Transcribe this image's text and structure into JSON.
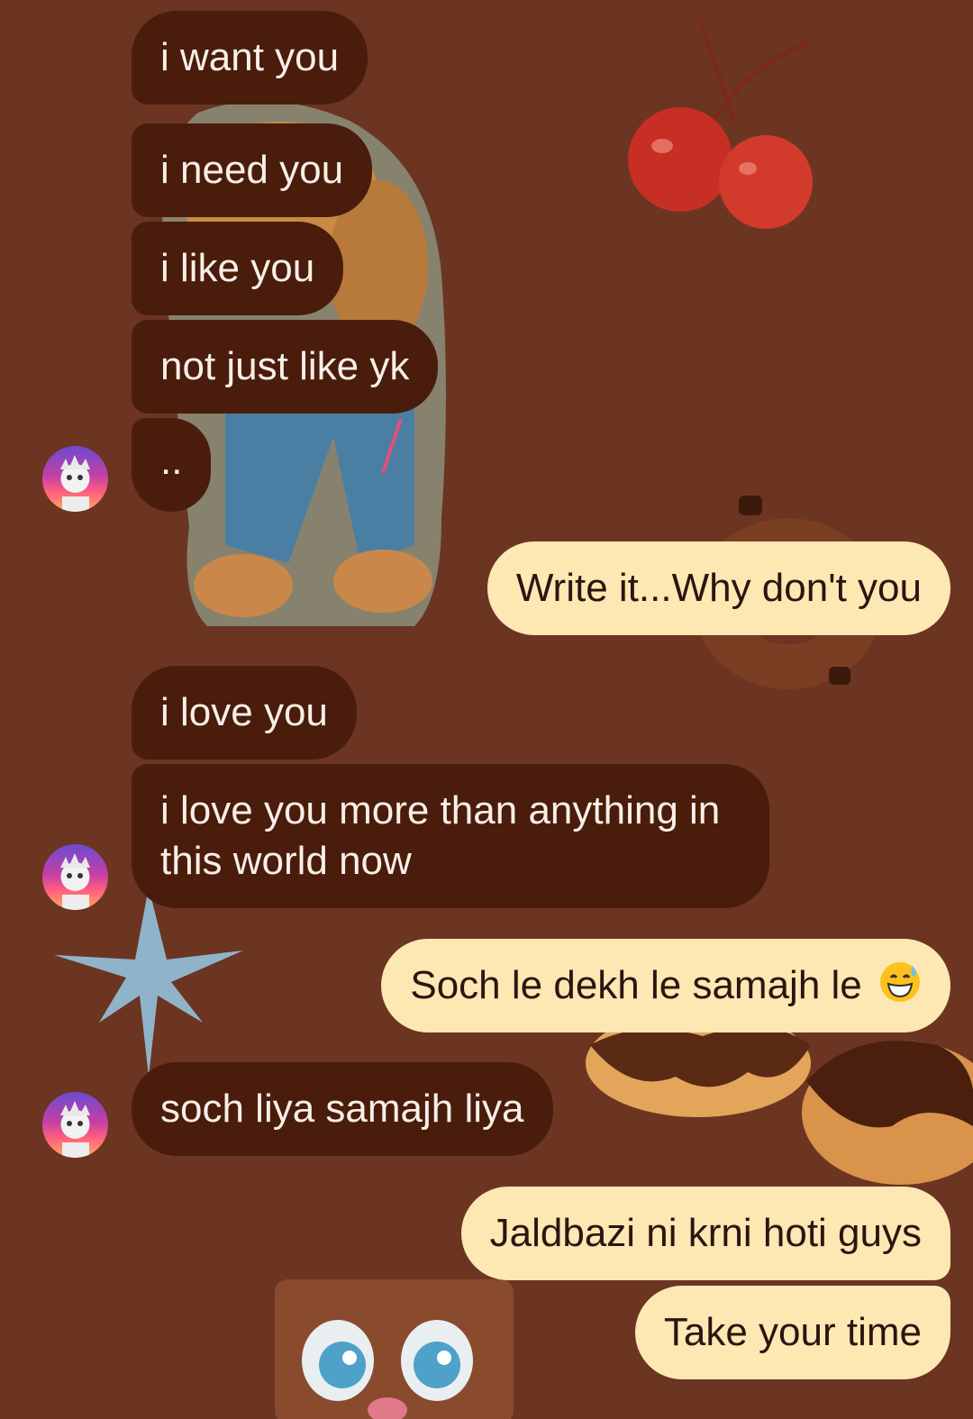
{
  "conversation": {
    "messages": [
      {
        "side": "in",
        "text": "i want you"
      },
      {
        "side": "in",
        "text": "i need you"
      },
      {
        "side": "in",
        "text": "i like you"
      },
      {
        "side": "in",
        "text": "not just like yk"
      },
      {
        "side": "in",
        "text": ".."
      },
      {
        "side": "out",
        "text": "Write it...Why don't you"
      },
      {
        "side": "in",
        "text": "i love you"
      },
      {
        "side": "in",
        "text": "i love you more than anything in this world now"
      },
      {
        "side": "out",
        "text": "Soch le dekh le samajh le",
        "emoji": "grinning-sweat-emoji"
      },
      {
        "side": "in",
        "text": "soch liya samajh liya"
      },
      {
        "side": "out",
        "text": "Jaldbazi ni krni hoti guys"
      },
      {
        "side": "out",
        "text": "Take your time"
      }
    ]
  },
  "theme": {
    "background": "#6b3521",
    "incoming_bubble": "#4a1c0b",
    "outgoing_bubble": "#fde7b3"
  },
  "stickers": [
    "cherries",
    "teddy-bear",
    "cookie",
    "star",
    "donuts",
    "chocolate-face"
  ]
}
